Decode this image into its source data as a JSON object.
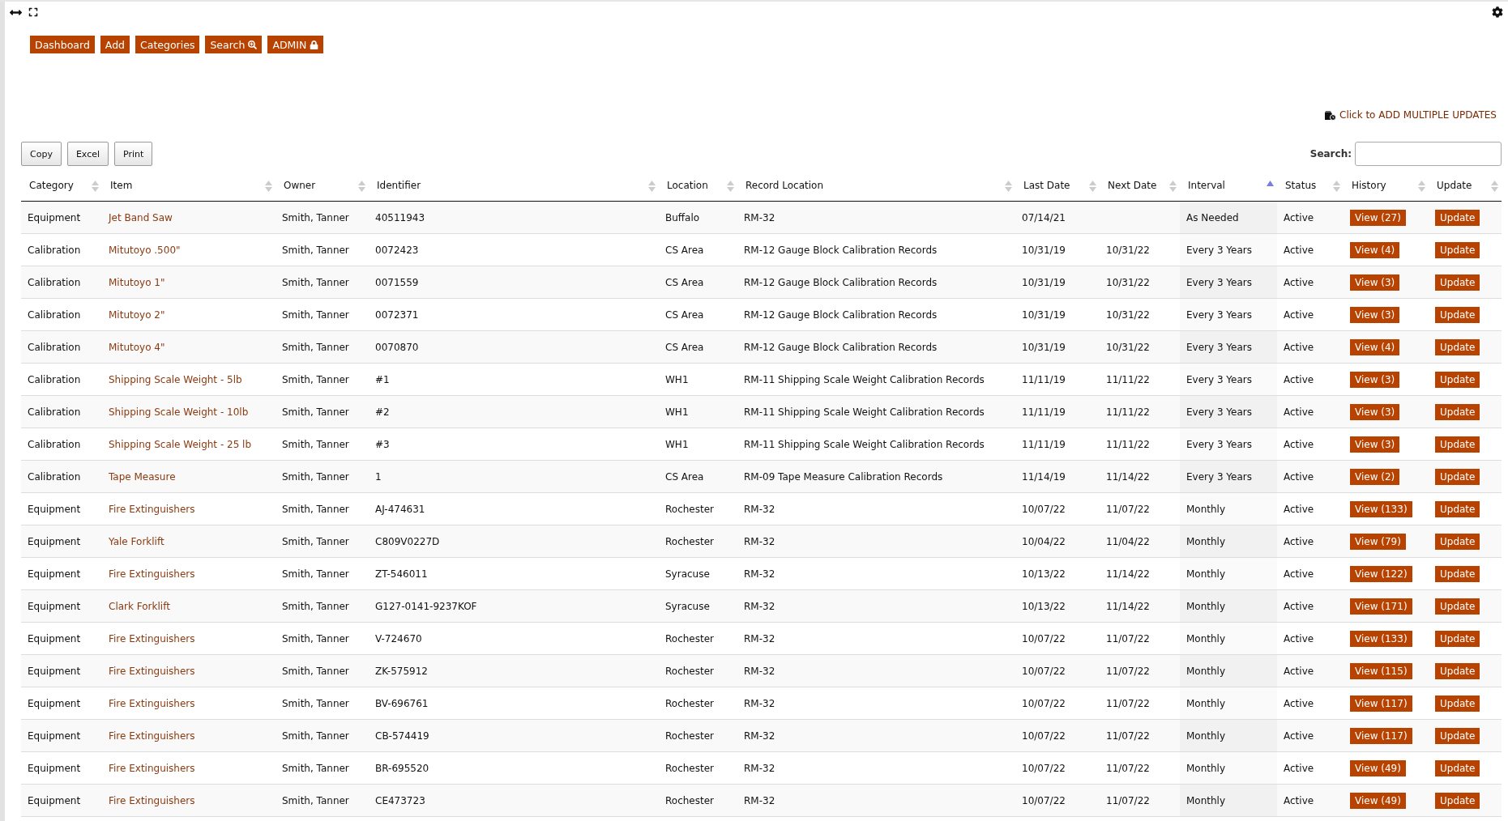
{
  "nav": [
    {
      "label": "Dashboard",
      "kind": "plain"
    },
    {
      "label": "Add",
      "kind": "plain"
    },
    {
      "label": "Categories",
      "kind": "plain"
    },
    {
      "label": "Search",
      "kind": "search"
    },
    {
      "label": "ADMIN",
      "kind": "lock"
    }
  ],
  "multi_update_link": "Click to ADD MULTIPLE UPDATES",
  "export_buttons": [
    "Copy",
    "Excel",
    "Print"
  ],
  "search": {
    "label": "Search:"
  },
  "table": {
    "columns": [
      {
        "label": "Category",
        "sorted": false
      },
      {
        "label": "Item",
        "sorted": false
      },
      {
        "label": "Owner",
        "sorted": false
      },
      {
        "label": "Identifier",
        "sorted": false
      },
      {
        "label": "Location",
        "sorted": false
      },
      {
        "label": "Record Location",
        "sorted": false
      },
      {
        "label": "Last Date",
        "sorted": false
      },
      {
        "label": "Next Date",
        "sorted": false
      },
      {
        "label": "Interval",
        "sorted": true
      },
      {
        "label": "Status",
        "sorted": false
      },
      {
        "label": "History",
        "sorted": false
      },
      {
        "label": "Update",
        "sorted": false
      }
    ],
    "rows": [
      {
        "category": "Equipment",
        "item": "Jet Band Saw",
        "owner": "Smith, Tanner",
        "identifier": "40511943",
        "location": "Buffalo",
        "record_location": "RM-32",
        "last_date": "07/14/21",
        "interval": "As Needed",
        "status": "Active",
        "history": "View (27)",
        "update": "Update"
      },
      {
        "category": "Calibration",
        "item": "Mitutoyo .500\"",
        "owner": "Smith, Tanner",
        "identifier": "0072423",
        "location": "CS Area",
        "record_location": "RM-12 Gauge Block Calibration Records",
        "last_date": "10/31/19",
        "next_date": "10/31/22",
        "interval": "Every 3 Years",
        "status": "Active",
        "history": "View (4)",
        "update": "Update"
      },
      {
        "category": "Calibration",
        "item": "Mitutoyo 1\"",
        "owner": "Smith, Tanner",
        "identifier": "0071559",
        "location": "CS Area",
        "record_location": "RM-12 Gauge Block Calibration Records",
        "last_date": "10/31/19",
        "next_date": "10/31/22",
        "interval": "Every 3 Years",
        "status": "Active",
        "history": "View (3)",
        "update": "Update"
      },
      {
        "category": "Calibration",
        "item": "Mitutoyo 2\"",
        "owner": "Smith, Tanner",
        "identifier": "0072371",
        "location": "CS Area",
        "record_location": "RM-12 Gauge Block Calibration Records",
        "last_date": "10/31/19",
        "next_date": "10/31/22",
        "interval": "Every 3 Years",
        "status": "Active",
        "history": "View (3)",
        "update": "Update"
      },
      {
        "category": "Calibration",
        "item": "Mitutoyo 4\"",
        "owner": "Smith, Tanner",
        "identifier": "0070870",
        "location": "CS Area",
        "record_location": "RM-12 Gauge Block Calibration Records",
        "last_date": "10/31/19",
        "next_date": "10/31/22",
        "interval": "Every 3 Years",
        "status": "Active",
        "history": "View (4)",
        "update": "Update"
      },
      {
        "category": "Calibration",
        "item": "Shipping Scale Weight - 5lb",
        "owner": "Smith, Tanner",
        "identifier": "#1",
        "location": "WH1",
        "record_location": "RM-11 Shipping Scale Weight Calibration Records",
        "last_date": "11/11/19",
        "next_date": "11/11/22",
        "interval": "Every 3 Years",
        "status": "Active",
        "history": "View (3)",
        "update": "Update"
      },
      {
        "category": "Calibration",
        "item": "Shipping Scale Weight - 10lb",
        "owner": "Smith, Tanner",
        "identifier": "#2",
        "location": "WH1",
        "record_location": "RM-11 Shipping Scale Weight Calibration Records",
        "last_date": "11/11/19",
        "next_date": "11/11/22",
        "interval": "Every 3 Years",
        "status": "Active",
        "history": "View (3)",
        "update": "Update"
      },
      {
        "category": "Calibration",
        "item": "Shipping Scale Weight - 25 lb",
        "owner": "Smith, Tanner",
        "identifier": "#3",
        "location": "WH1",
        "record_location": "RM-11 Shipping Scale Weight Calibration Records",
        "last_date": "11/11/19",
        "next_date": "11/11/22",
        "interval": "Every 3 Years",
        "status": "Active",
        "history": "View (3)",
        "update": "Update"
      },
      {
        "category": "Calibration",
        "item": "Tape Measure",
        "owner": "Smith, Tanner",
        "identifier": "1",
        "location": "CS Area",
        "record_location": "RM-09 Tape Measure Calibration Records",
        "last_date": "11/14/19",
        "next_date": "11/14/22",
        "interval": "Every 3 Years",
        "status": "Active",
        "history": "View (2)",
        "update": "Update"
      },
      {
        "category": "Equipment",
        "item": "Fire Extinguishers",
        "owner": "Smith, Tanner",
        "identifier": "AJ-474631",
        "location": "Rochester",
        "record_location": "RM-32",
        "last_date": "10/07/22",
        "next_date": "11/07/22",
        "interval": "Monthly",
        "status": "Active",
        "history": "View (133)",
        "update": "Update"
      },
      {
        "category": "Equipment",
        "item": "Yale Forklift",
        "owner": "Smith, Tanner",
        "identifier": "C809V0227D",
        "location": "Rochester",
        "record_location": "RM-32",
        "last_date": "10/04/22",
        "next_date": "11/04/22",
        "interval": "Monthly",
        "status": "Active",
        "history": "View (79)",
        "update": "Update"
      },
      {
        "category": "Equipment",
        "item": "Fire Extinguishers",
        "owner": "Smith, Tanner",
        "identifier": "ZT-546011",
        "location": "Syracuse",
        "record_location": "RM-32",
        "last_date": "10/13/22",
        "next_date": "11/14/22",
        "interval": "Monthly",
        "status": "Active",
        "history": "View (122)",
        "update": "Update"
      },
      {
        "category": "Equipment",
        "item": "Clark Forklift",
        "owner": "Smith, Tanner",
        "identifier": "G127-0141-9237KOF",
        "location": "Syracuse",
        "record_location": "RM-32",
        "last_date": "10/13/22",
        "next_date": "11/14/22",
        "interval": "Monthly",
        "status": "Active",
        "history": "View (171)",
        "update": "Update"
      },
      {
        "category": "Equipment",
        "item": "Fire Extinguishers",
        "owner": "Smith, Tanner",
        "identifier": "V-724670",
        "location": "Rochester",
        "record_location": "RM-32",
        "last_date": "10/07/22",
        "next_date": "11/07/22",
        "interval": "Monthly",
        "status": "Active",
        "history": "View (133)",
        "update": "Update"
      },
      {
        "category": "Equipment",
        "item": "Fire Extinguishers",
        "owner": "Smith, Tanner",
        "identifier": "ZK-575912",
        "location": "Rochester",
        "record_location": "RM-32",
        "last_date": "10/07/22",
        "next_date": "11/07/22",
        "interval": "Monthly",
        "status": "Active",
        "history": "View (115)",
        "update": "Update"
      },
      {
        "category": "Equipment",
        "item": "Fire Extinguishers",
        "owner": "Smith, Tanner",
        "identifier": "BV-696761",
        "location": "Rochester",
        "record_location": "RM-32",
        "last_date": "10/07/22",
        "next_date": "11/07/22",
        "interval": "Monthly",
        "status": "Active",
        "history": "View (117)",
        "update": "Update"
      },
      {
        "category": "Equipment",
        "item": "Fire Extinguishers",
        "owner": "Smith, Tanner",
        "identifier": "CB-574419",
        "location": "Rochester",
        "record_location": "RM-32",
        "last_date": "10/07/22",
        "next_date": "11/07/22",
        "interval": "Monthly",
        "status": "Active",
        "history": "View (117)",
        "update": "Update"
      },
      {
        "category": "Equipment",
        "item": "Fire Extinguishers",
        "owner": "Smith, Tanner",
        "identifier": "BR-695520",
        "location": "Rochester",
        "record_location": "RM-32",
        "last_date": "10/07/22",
        "next_date": "11/07/22",
        "interval": "Monthly",
        "status": "Active",
        "history": "View (49)",
        "update": "Update"
      },
      {
        "category": "Equipment",
        "item": "Fire Extinguishers",
        "owner": "Smith, Tanner",
        "identifier": "CE473723",
        "location": "Rochester",
        "record_location": "RM-32",
        "last_date": "10/07/22",
        "next_date": "11/07/22",
        "interval": "Monthly",
        "status": "Active",
        "history": "View (49)",
        "update": "Update"
      }
    ]
  }
}
